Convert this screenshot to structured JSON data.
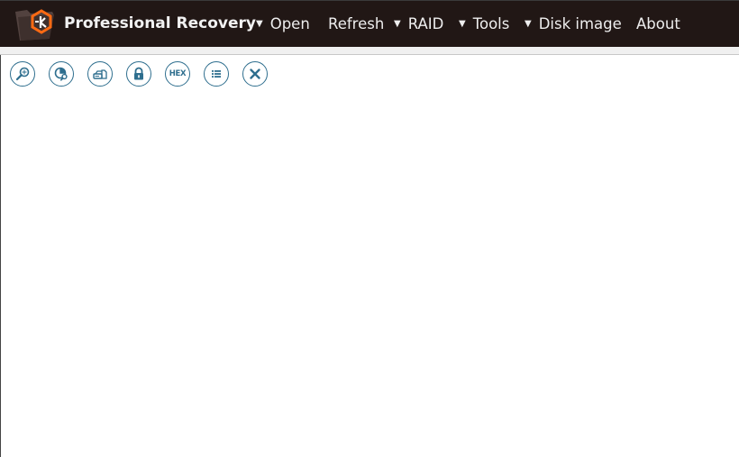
{
  "app": {
    "title": "Professional Recovery",
    "logo_icon": "folder-hexagon-logo"
  },
  "menu": [
    {
      "label": "Open",
      "has_dropdown": true
    },
    {
      "label": "Refresh",
      "has_dropdown": false
    },
    {
      "label": "RAID",
      "has_dropdown": true
    },
    {
      "label": "Tools",
      "has_dropdown": true
    },
    {
      "label": "Disk image",
      "has_dropdown": true
    },
    {
      "label": "About",
      "has_dropdown": false
    }
  ],
  "toolbar": [
    {
      "icon": "search-icon"
    },
    {
      "icon": "partition-search-icon"
    },
    {
      "icon": "drives-icon"
    },
    {
      "icon": "lock-icon"
    },
    {
      "icon": "hex-icon",
      "label": "HEX"
    },
    {
      "icon": "list-icon"
    },
    {
      "icon": "close-icon"
    }
  ],
  "colors": {
    "titlebar": "#211715",
    "accent_orange": "#ff6a13",
    "icon_blue": "#2e6e8e"
  }
}
